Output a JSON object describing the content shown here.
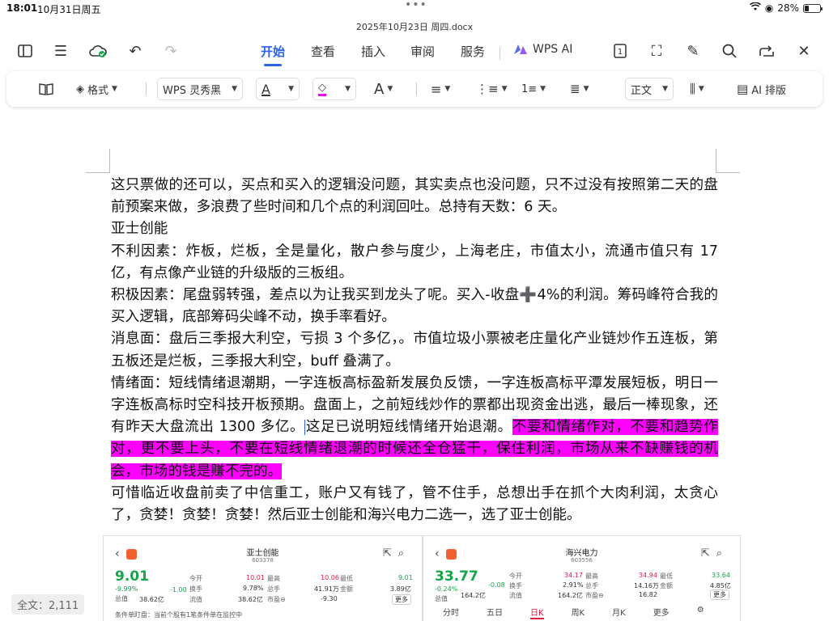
{
  "status": {
    "time": "18:01",
    "date": "10月31日周五",
    "battery": "28%",
    "battery_level": 0.28
  },
  "document": {
    "title": "2025年10月23日 周四.docx"
  },
  "tabs": [
    {
      "label": "开始",
      "active": true
    },
    {
      "label": "查看"
    },
    {
      "label": "插入"
    },
    {
      "label": "审阅"
    },
    {
      "label": "服务"
    }
  ],
  "wps_ai": "WPS AI",
  "ribbon": {
    "format_label": "格式",
    "font_name": "WPS 灵秀黑",
    "style_label": "正文",
    "ai_layout_label": "AI 排版"
  },
  "body": {
    "para1": "这只票做的还可以，买点和买入的逻辑没问题，其实卖点也没问题，只不过没有按照第二天的盘前预案来做，多浪费了些时间和几个点的利润回吐。总持有天数：6 天。",
    "para2": "亚士创能",
    "para3": "不利因素：炸板，烂板，全是量化，散户参与度少，上海老庄，市值太小，流通市值只有 17 亿，有点像产业链的升级版的三板组。",
    "para4": "积极因素：尾盘弱转强，差点以为让我买到龙头了呢。买入-收盘➕4%的利润。筹码峰符合我的买入逻辑，底部筹码尖峰不动，换手率看好。",
    "para5": "消息面：盘后三季报大利空，亏损 3 个多亿，。市值垃圾小票被老庄量化产业链炒作五连板，第五板还是烂板，三季报大利空，buff 叠满了。",
    "para6_a": "情绪面：短线情绪退潮期，一字连板高标盈新发展负反馈，一字连板高标平潭发展短板，明日一字连板高标时空科技开板预期。盘面上，之前短线炒作的票都出现资金出逃，最后一棒现象，还有昨天大盘流出 1300 多亿。",
    "para6_b": "这足已说明短线情绪开始退潮。",
    "para6_hl": "不要和情绪作对，不要和趋势作对，更不要上头，不要在短线情绪退潮的时候还全仓猛干，保住利润，市场从来不缺赚钱的机会，市场的钱是赚不完的。",
    "para7": "可惜临近收盘前卖了中信重工，账户又有钱了，管不住手，总想出手在抓个大肉利润，太贪心了，贪婪！贪婪！贪婪！然后亚士创能和海兴电力二选一，选了亚士创能。"
  },
  "stock_left": {
    "name": "亚士创能",
    "code": "603378",
    "price": "9.01",
    "change_pct": "-9.99%",
    "change": "-1.00",
    "l_open": "今开",
    "open": "10.01",
    "l_high": "最高",
    "high": "10.06",
    "l_low": "最低",
    "low": "9.01",
    "l_turnover": "换手",
    "turnover": "9.78%",
    "l_total": "总手",
    "total": "41.91万",
    "l_amount": "金额",
    "amount": "3.89亿",
    "l_mcap": "总值",
    "mcap": "38.62亿",
    "l_float": "流值",
    "float": "38.62亿",
    "l_pe": "市盈⊖",
    "pe": "-9.30",
    "more": "更多",
    "notice": "条件单盯盘：当前个股有1笔条件单在监控中"
  },
  "stock_right": {
    "name": "海兴电力",
    "code": "603556",
    "price": "33.77",
    "change_pct": "-0.24%",
    "change": "-0.08",
    "l_open": "今开",
    "open": "34.17",
    "l_high": "最高",
    "high": "34.94",
    "l_low": "最低",
    "low": "33.64",
    "l_turnover": "换手",
    "turnover": "2.91%",
    "l_total": "总手",
    "total": "14.16万",
    "l_amount": "金额",
    "amount": "4.85亿",
    "l_mcap": "总值",
    "mcap": "164.2亿",
    "l_float": "流值",
    "float": "164.2亿",
    "l_pe": "市盈⊖",
    "pe": "16.82",
    "more": "更多",
    "tabs": [
      "分时",
      "五日",
      "日K",
      "周K",
      "月K",
      "更多"
    ]
  },
  "word_count": "全文：2,111",
  "colors": {
    "accent": "#2a63e8",
    "highlight": "#ff00ff",
    "up": "#e11d48",
    "down": "#16a34a"
  }
}
